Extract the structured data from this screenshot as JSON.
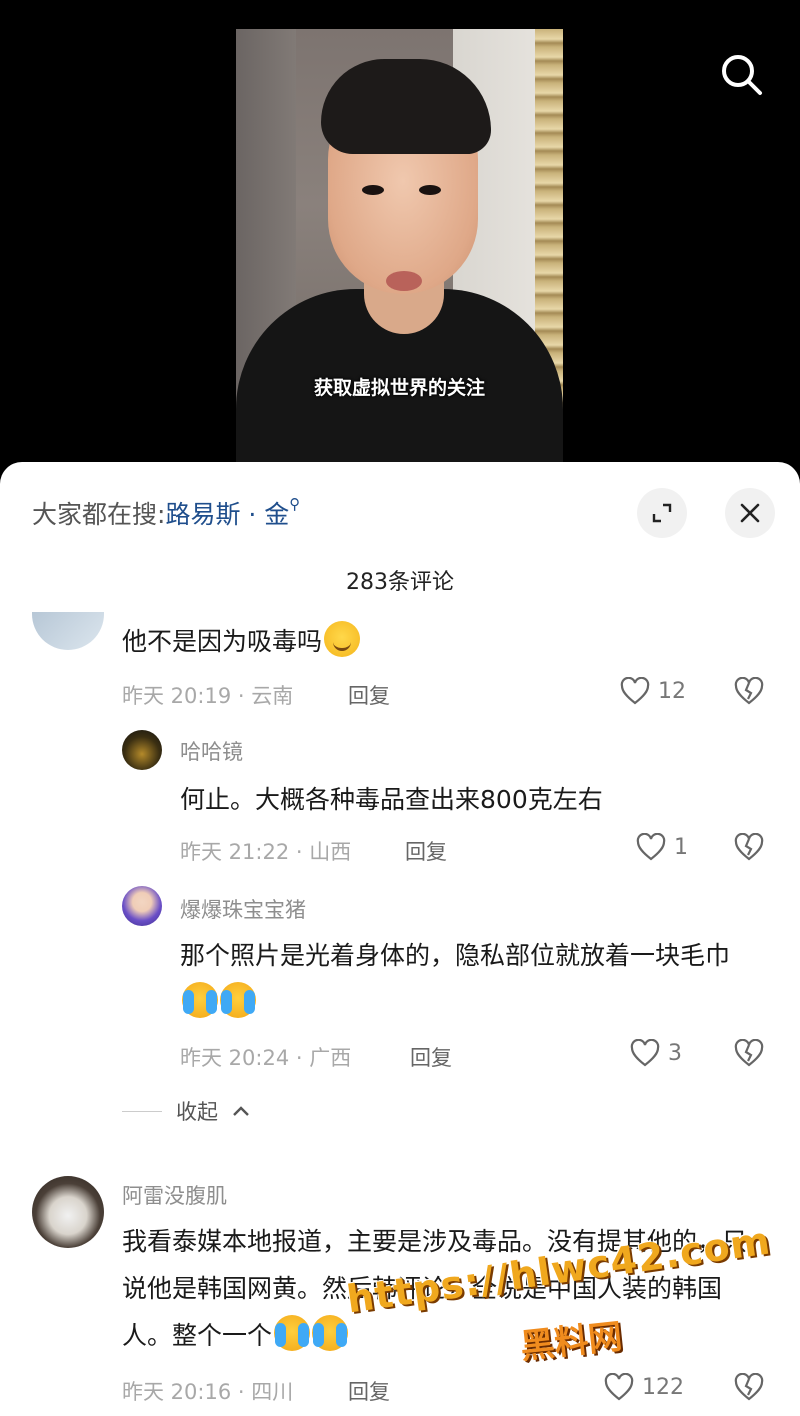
{
  "video": {
    "caption": "获取虚拟世界的关注"
  },
  "top_bar": {
    "search_icon": "search-icon"
  },
  "sheet": {
    "hot_search_prefix": "大家都在搜:",
    "hot_search_keyword": "路易斯 · 金",
    "comment_count": "283条评论",
    "collapse_label": "收起",
    "expand_icon": "expand-icon",
    "close_icon": "close-icon"
  },
  "comments": [
    {
      "text": "他不是因为吸毒吗",
      "emoji": "smile",
      "time_location": "昨天 20:19 · 云南",
      "reply_label": "回复",
      "likes": "12"
    },
    {
      "user": "哈哈镜",
      "text": "何止。大概各种毒品查出来800克左右",
      "time_location": "昨天 21:22 · 山西",
      "reply_label": "回复",
      "likes": "1"
    },
    {
      "user": "爆爆珠宝宝猪",
      "text": "那个照片是光着身体的，隐私部位就放着一块毛巾",
      "emoji": "cry-laugh x2",
      "time_location": "昨天 20:24 · 广西",
      "reply_label": "回复",
      "likes": "3"
    },
    {
      "user": "阿雷没腹肌",
      "text": "我看泰媒本地报道，主要是涉及毒品。没有提其他的，只说他是韩国网黄。然后韩评论，全说是中国人装的韩国人。整个一个",
      "emoji": "cry-laugh x2",
      "time_location": "昨天 20:16 · 四川",
      "reply_label": "回复",
      "likes": "122"
    }
  ],
  "watermark": {
    "url": "https://hlwc42.com",
    "name": "黑料网"
  }
}
